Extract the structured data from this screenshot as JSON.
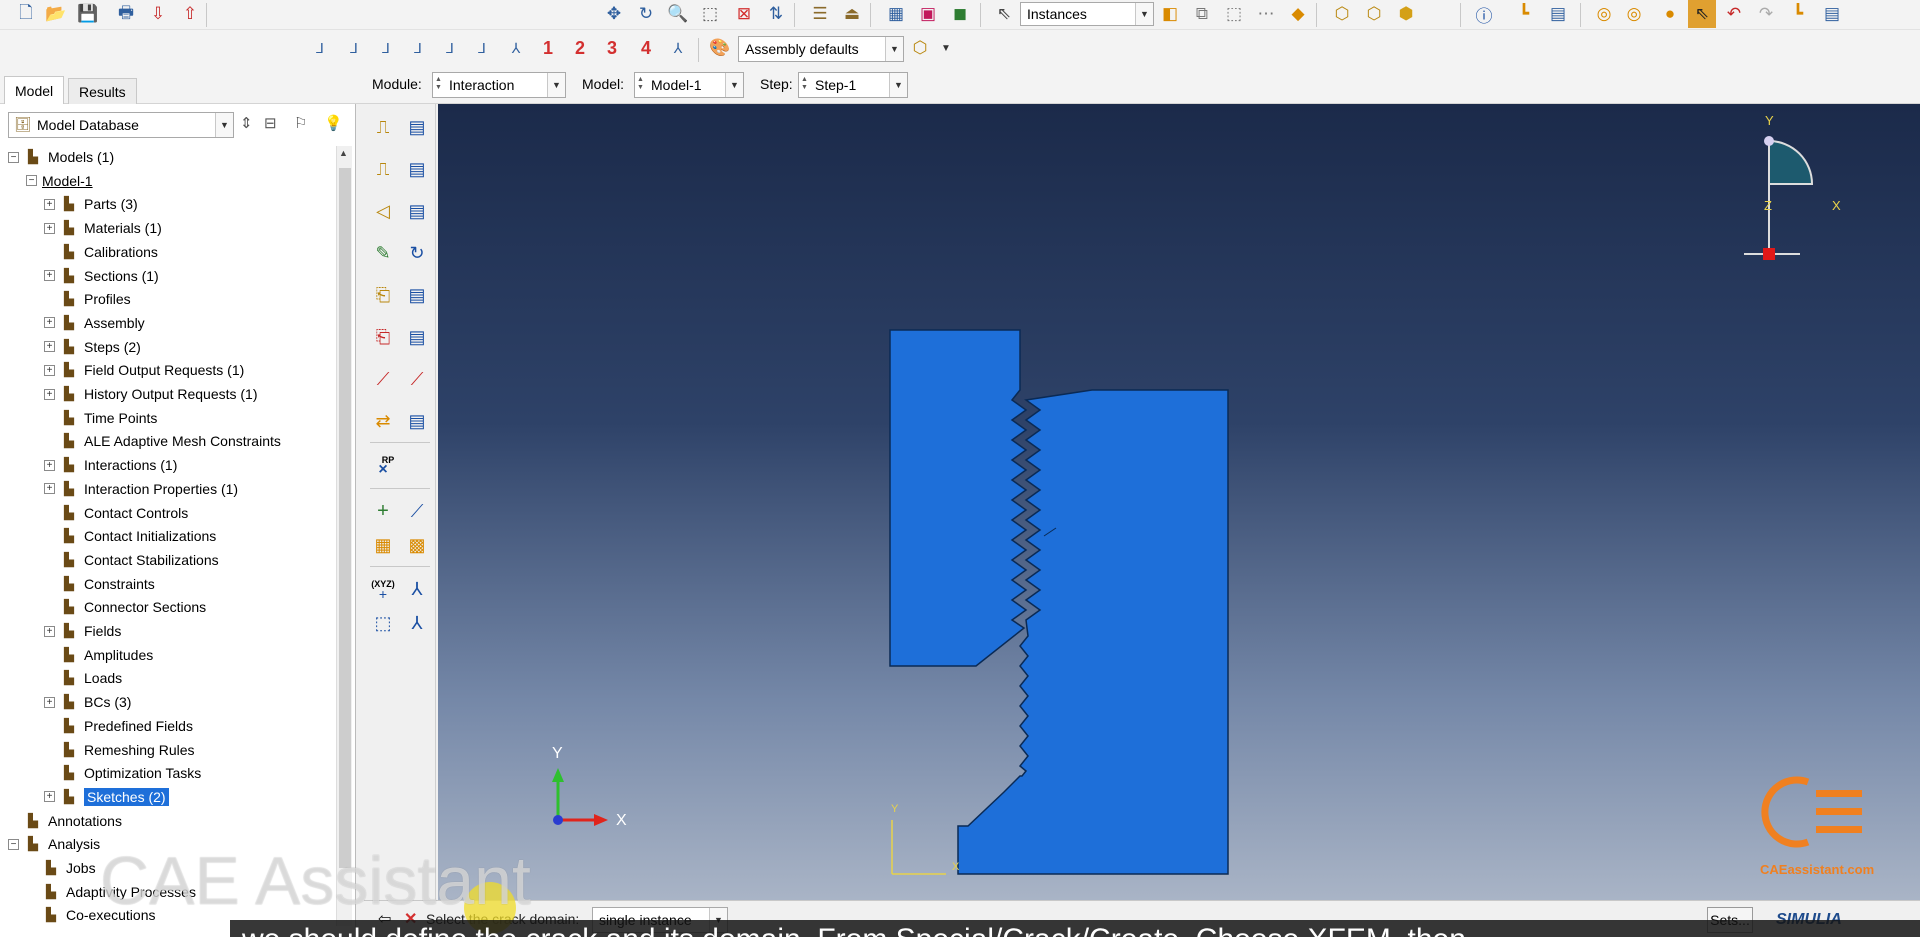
{
  "toolbar": {
    "icons_row1": [
      "new-file-icon",
      "open-file-icon",
      "save-icon",
      "print-icon",
      "import-icon",
      "export-icon",
      "pan-icon",
      "rotate-icon",
      "magnify-icon",
      "box-zoom-icon",
      "auto-fit-icon",
      "cycle-views-icon",
      "render-wireframe-icon",
      "render-hidden-icon",
      "render-shaded-icon",
      "view-iso-icon",
      "select-icon",
      "query-icon",
      "frame-icon",
      "layer-icon",
      "perspective-icon",
      "front-view-icon",
      "back-view-icon",
      "left-view-icon",
      "info-icon",
      "feature-manager-icon",
      "boolean-icon",
      "color-icon",
      "pick-icon",
      "undo-icon",
      "redo-icon",
      "replace-icon",
      "tables-icon"
    ],
    "instances_value": "Instances",
    "views_numbers": [
      "1",
      "2",
      "3",
      "4"
    ],
    "render_style_value": "Assembly defaults"
  },
  "context_bar": {
    "module_label": "Module:",
    "module_value": "Interaction",
    "model_label": "Model:",
    "model_value": "Model-1",
    "step_label": "Step:",
    "step_value": "Step-1"
  },
  "tabs": {
    "model": "Model",
    "results": "Results"
  },
  "tree": {
    "root_combo": "Model Database",
    "items": [
      {
        "label": "Models (1)",
        "level": 0,
        "expander": "minus",
        "icon": "models-icon"
      },
      {
        "label": "Model-1",
        "level": 1,
        "expander": "minus",
        "icon": ""
      },
      {
        "label": "Parts (3)",
        "level": 2,
        "expander": "plus",
        "icon": "parts-icon"
      },
      {
        "label": "Materials (1)",
        "level": 2,
        "expander": "plus",
        "icon": "materials-icon"
      },
      {
        "label": "Calibrations",
        "level": 2,
        "expander": "none",
        "icon": "calibrations-icon"
      },
      {
        "label": "Sections (1)",
        "level": 2,
        "expander": "plus",
        "icon": "sections-icon"
      },
      {
        "label": "Profiles",
        "level": 2,
        "expander": "none",
        "icon": "profiles-icon"
      },
      {
        "label": "Assembly",
        "level": 2,
        "expander": "plus",
        "icon": "assembly-icon"
      },
      {
        "label": "Steps (2)",
        "level": 2,
        "expander": "plus",
        "icon": "steps-icon"
      },
      {
        "label": "Field Output Requests (1)",
        "level": 2,
        "expander": "plus",
        "icon": "field-output-icon"
      },
      {
        "label": "History Output Requests (1)",
        "level": 2,
        "expander": "plus",
        "icon": "history-output-icon"
      },
      {
        "label": "Time Points",
        "level": 2,
        "expander": "none",
        "icon": "time-points-icon"
      },
      {
        "label": "ALE Adaptive Mesh Constraints",
        "level": 2,
        "expander": "none",
        "icon": "ale-mesh-icon"
      },
      {
        "label": "Interactions (1)",
        "level": 2,
        "expander": "plus",
        "icon": "interactions-icon"
      },
      {
        "label": "Interaction Properties (1)",
        "level": 2,
        "expander": "plus",
        "icon": "interaction-properties-icon"
      },
      {
        "label": "Contact Controls",
        "level": 2,
        "expander": "none",
        "icon": "contact-controls-icon"
      },
      {
        "label": "Contact Initializations",
        "level": 2,
        "expander": "none",
        "icon": "contact-init-icon"
      },
      {
        "label": "Contact Stabilizations",
        "level": 2,
        "expander": "none",
        "icon": "contact-stab-icon"
      },
      {
        "label": "Constraints",
        "level": 2,
        "expander": "none",
        "icon": "constraints-icon"
      },
      {
        "label": "Connector Sections",
        "level": 2,
        "expander": "none",
        "icon": "connector-sections-icon"
      },
      {
        "label": "Fields",
        "level": 2,
        "expander": "plus",
        "icon": "fields-icon"
      },
      {
        "label": "Amplitudes",
        "level": 2,
        "expander": "none",
        "icon": "amplitudes-icon"
      },
      {
        "label": "Loads",
        "level": 2,
        "expander": "none",
        "icon": "loads-icon"
      },
      {
        "label": "BCs (3)",
        "level": 2,
        "expander": "plus",
        "icon": "bcs-icon"
      },
      {
        "label": "Predefined Fields",
        "level": 2,
        "expander": "none",
        "icon": "predefined-fields-icon"
      },
      {
        "label": "Remeshing Rules",
        "level": 2,
        "expander": "none",
        "icon": "remeshing-icon"
      },
      {
        "label": "Optimization Tasks",
        "level": 2,
        "expander": "none",
        "icon": "optimization-icon"
      },
      {
        "label": "Sketches (2)",
        "level": 2,
        "expander": "plus",
        "icon": "sketches-icon",
        "selected": true
      },
      {
        "label": "Annotations",
        "level": 0,
        "expander": "none",
        "icon": "annotations-icon"
      },
      {
        "label": "Analysis",
        "level": 0,
        "expander": "minus",
        "icon": "analysis-icon"
      },
      {
        "label": "Jobs",
        "level": 1,
        "expander": "none",
        "icon": "jobs-icon"
      },
      {
        "label": "Adaptivity Processes",
        "level": 1,
        "expander": "none",
        "icon": "adaptivity-icon"
      },
      {
        "label": "Co-executions",
        "level": 1,
        "expander": "none",
        "icon": "co-executions-icon"
      }
    ]
  },
  "toolbox": {
    "rp_label": "RP",
    "xyz_label": "(XYZ)"
  },
  "viewport": {
    "triad_y": "Y",
    "triad_x": "X",
    "view_triad_x": "X",
    "view_triad_y": "Y",
    "view_triad_z": "Z",
    "part_csys_x": "X",
    "part_csys_y": "Y",
    "part_color": "#1e6fd9",
    "logo_text": "CAEassistant.com"
  },
  "prompt": {
    "text": "Select the crack domain:",
    "selection_mode": "single instance",
    "sets_button": "Sets...",
    "brand": "SIMULIA"
  },
  "overlay": {
    "watermark": "CAE Assistant",
    "subtitle": "we should define the crack and its domain. From Special/Crack/Create, Choose XFEM, then"
  }
}
